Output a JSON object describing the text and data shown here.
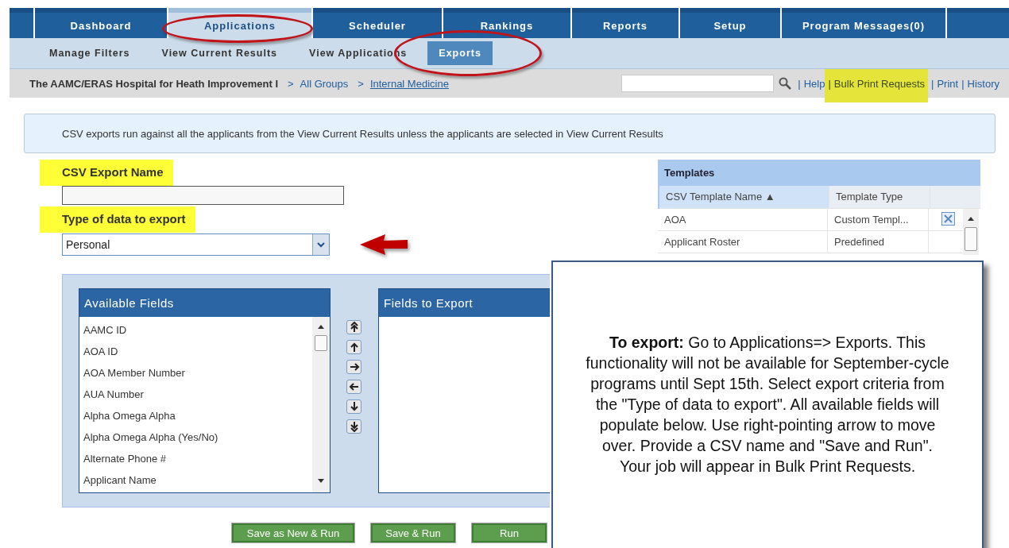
{
  "nav_tabs": [
    {
      "label": "Dashboard",
      "selected": false,
      "circled": false
    },
    {
      "label": "Applications",
      "selected": true,
      "circled": true
    },
    {
      "label": "Scheduler",
      "selected": false,
      "circled": false
    },
    {
      "label": "Rankings",
      "selected": false,
      "circled": false
    },
    {
      "label": "Reports",
      "selected": false,
      "circled": false
    },
    {
      "label": "Setup",
      "selected": false,
      "circled": false
    },
    {
      "label": "Program Messages(0)",
      "selected": false,
      "circled": false
    }
  ],
  "sub_tabs": [
    {
      "label": "Manage Filters",
      "selected": false,
      "circled": false
    },
    {
      "label": "View Current Results",
      "selected": false,
      "circled": false
    },
    {
      "label": "View Applications",
      "selected": false,
      "circled": false
    },
    {
      "label": "Exports",
      "selected": true,
      "circled": true
    }
  ],
  "breadcrumb": {
    "program": "The AAMC/ERAS Hospital for Heath Improvement I",
    "separator": ">",
    "items": [
      "All Groups",
      "Internal Medicine"
    ]
  },
  "link_separator": "|",
  "header_links": [
    {
      "label": "Help",
      "highlighted": false
    },
    {
      "label": "Bulk Print Requests",
      "highlighted": true
    },
    {
      "label": "Print",
      "highlighted": false
    },
    {
      "label": "History",
      "highlighted": false
    }
  ],
  "info_message": "CSV exports run against all the applicants from the View Current Results unless the applicants are selected in View Current Results",
  "export_name": {
    "label": "CSV Export Name",
    "highlighted": true
  },
  "data_type": {
    "label": "Type of data to export",
    "highlighted": true,
    "value": "Personal",
    "pointed": true
  },
  "templates": {
    "title": "Templates",
    "columns": [
      "CSV Template Name ▲",
      "Template Type"
    ],
    "rows": [
      {
        "name": "AOA",
        "type": "Custom Templ...",
        "deletable": true
      },
      {
        "name": "Applicant Roster",
        "type": "Predefined",
        "deletable": false
      }
    ]
  },
  "available_fields": {
    "title": "Available Fields",
    "items": [
      "AAMC ID",
      "AOA ID",
      "AOA Member Number",
      "AUA Number",
      "Alpha Omega Alpha",
      "Alpha Omega Alpha (Yes/No)",
      "Alternate Phone #",
      "Applicant Name"
    ]
  },
  "fields_to_export": {
    "title": "Fields to Export"
  },
  "buttons": [
    "Save as New & Run",
    "Save & Run",
    "Run"
  ],
  "callout": "**To export:** Go to Applications=> Exports. This functionality will not be available for September-cycle programs until Sept 15th. Select export criteria from the \"Type of data to export\". All available fields will populate below. Use right-pointing arrow to move over. Provide a CSV name and \"Save and Run\". Your job will appear in Bulk Print Requests."
}
